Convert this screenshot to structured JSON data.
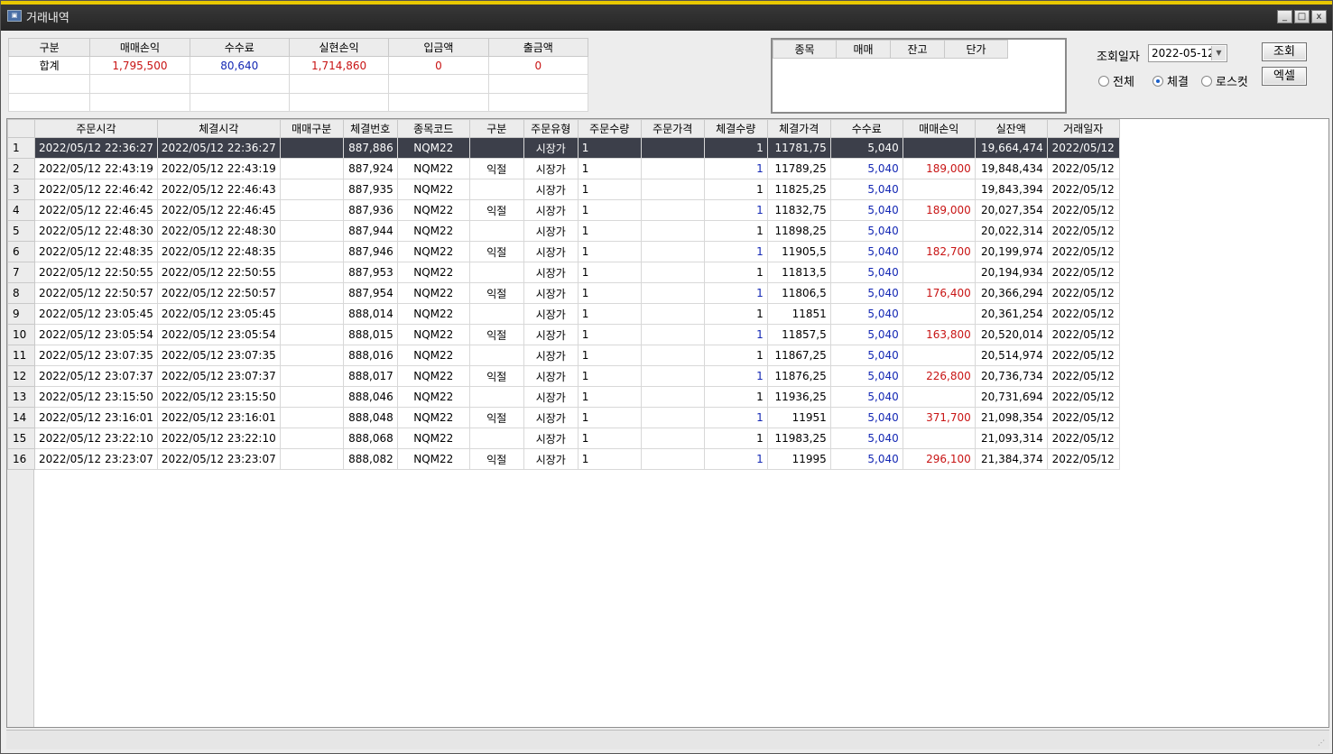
{
  "window": {
    "title": "거래내역",
    "icon": "app-icon",
    "minimize": "_",
    "maximize": "□",
    "close": "x"
  },
  "summary": {
    "headers": [
      "구분",
      "매매손익",
      "수수료",
      "실현손익",
      "입금액",
      "출금액"
    ],
    "rows": [
      [
        "합계",
        "1,795,500",
        "80,640",
        "1,714,860",
        "0",
        "0"
      ],
      [
        "",
        "",
        "",
        "",
        "",
        ""
      ],
      [
        "",
        "",
        "",
        "",
        "",
        ""
      ]
    ]
  },
  "positions": {
    "headers": [
      "종목",
      "매매",
      "잔고",
      "단가"
    ]
  },
  "controls": {
    "date_label": "조회일자",
    "date_value": "2022-05-12",
    "query_button": "조회",
    "excel_button": "엑셀",
    "radio_all": "전체",
    "radio_filled": "체결",
    "radio_losscut": "로스컷",
    "selected_radio": "체결"
  },
  "trades": {
    "headers": [
      "주문시각",
      "체결시각",
      "매매구분",
      "체결번호",
      "종목코드",
      "구분",
      "주문유형",
      "주문수량",
      "주문가격",
      "체결수량",
      "체결가격",
      "수수료",
      "매매손익",
      "실잔액",
      "거래일자"
    ],
    "rows": [
      [
        "1",
        "2022/05/12 22:36:27",
        "2022/05/12 22:36:27",
        "",
        "887,886",
        "NQM22",
        "",
        "시장가",
        "1",
        "",
        "1",
        "11781,75",
        "5,040",
        "",
        "19,664,474",
        "2022/05/12"
      ],
      [
        "2",
        "2022/05/12 22:43:19",
        "2022/05/12 22:43:19",
        "",
        "887,924",
        "NQM22",
        "익절",
        "시장가",
        "1",
        "",
        "1",
        "11789,25",
        "5,040",
        "189,000",
        "19,848,434",
        "2022/05/12"
      ],
      [
        "3",
        "2022/05/12 22:46:42",
        "2022/05/12 22:46:43",
        "",
        "887,935",
        "NQM22",
        "",
        "시장가",
        "1",
        "",
        "1",
        "11825,25",
        "5,040",
        "",
        "19,843,394",
        "2022/05/12"
      ],
      [
        "4",
        "2022/05/12 22:46:45",
        "2022/05/12 22:46:45",
        "",
        "887,936",
        "NQM22",
        "익절",
        "시장가",
        "1",
        "",
        "1",
        "11832,75",
        "5,040",
        "189,000",
        "20,027,354",
        "2022/05/12"
      ],
      [
        "5",
        "2022/05/12 22:48:30",
        "2022/05/12 22:48:30",
        "",
        "887,944",
        "NQM22",
        "",
        "시장가",
        "1",
        "",
        "1",
        "11898,25",
        "5,040",
        "",
        "20,022,314",
        "2022/05/12"
      ],
      [
        "6",
        "2022/05/12 22:48:35",
        "2022/05/12 22:48:35",
        "",
        "887,946",
        "NQM22",
        "익절",
        "시장가",
        "1",
        "",
        "1",
        "11905,5",
        "5,040",
        "182,700",
        "20,199,974",
        "2022/05/12"
      ],
      [
        "7",
        "2022/05/12 22:50:55",
        "2022/05/12 22:50:55",
        "",
        "887,953",
        "NQM22",
        "",
        "시장가",
        "1",
        "",
        "1",
        "11813,5",
        "5,040",
        "",
        "20,194,934",
        "2022/05/12"
      ],
      [
        "8",
        "2022/05/12 22:50:57",
        "2022/05/12 22:50:57",
        "",
        "887,954",
        "NQM22",
        "익절",
        "시장가",
        "1",
        "",
        "1",
        "11806,5",
        "5,040",
        "176,400",
        "20,366,294",
        "2022/05/12"
      ],
      [
        "9",
        "2022/05/12 23:05:45",
        "2022/05/12 23:05:45",
        "",
        "888,014",
        "NQM22",
        "",
        "시장가",
        "1",
        "",
        "1",
        "11851",
        "5,040",
        "",
        "20,361,254",
        "2022/05/12"
      ],
      [
        "10",
        "2022/05/12 23:05:54",
        "2022/05/12 23:05:54",
        "",
        "888,015",
        "NQM22",
        "익절",
        "시장가",
        "1",
        "",
        "1",
        "11857,5",
        "5,040",
        "163,800",
        "20,520,014",
        "2022/05/12"
      ],
      [
        "11",
        "2022/05/12 23:07:35",
        "2022/05/12 23:07:35",
        "",
        "888,016",
        "NQM22",
        "",
        "시장가",
        "1",
        "",
        "1",
        "11867,25",
        "5,040",
        "",
        "20,514,974",
        "2022/05/12"
      ],
      [
        "12",
        "2022/05/12 23:07:37",
        "2022/05/12 23:07:37",
        "",
        "888,017",
        "NQM22",
        "익절",
        "시장가",
        "1",
        "",
        "1",
        "11876,25",
        "5,040",
        "226,800",
        "20,736,734",
        "2022/05/12"
      ],
      [
        "13",
        "2022/05/12 23:15:50",
        "2022/05/12 23:15:50",
        "",
        "888,046",
        "NQM22",
        "",
        "시장가",
        "1",
        "",
        "1",
        "11936,25",
        "5,040",
        "",
        "20,731,694",
        "2022/05/12"
      ],
      [
        "14",
        "2022/05/12 23:16:01",
        "2022/05/12 23:16:01",
        "",
        "888,048",
        "NQM22",
        "익절",
        "시장가",
        "1",
        "",
        "1",
        "11951",
        "5,040",
        "371,700",
        "21,098,354",
        "2022/05/12"
      ],
      [
        "15",
        "2022/05/12 23:22:10",
        "2022/05/12 23:22:10",
        "",
        "888,068",
        "NQM22",
        "",
        "시장가",
        "1",
        "",
        "1",
        "11983,25",
        "5,040",
        "",
        "21,093,314",
        "2022/05/12"
      ],
      [
        "16",
        "2022/05/12 23:23:07",
        "2022/05/12 23:23:07",
        "",
        "888,082",
        "NQM22",
        "익절",
        "시장가",
        "1",
        "",
        "1",
        "11995",
        "5,040",
        "296,100",
        "21,384,374",
        "2022/05/12"
      ]
    ],
    "selected_row": 1
  },
  "colors": {
    "profit": "#c81414",
    "fee": "#1428b4",
    "selection": "#3c3f4a"
  }
}
